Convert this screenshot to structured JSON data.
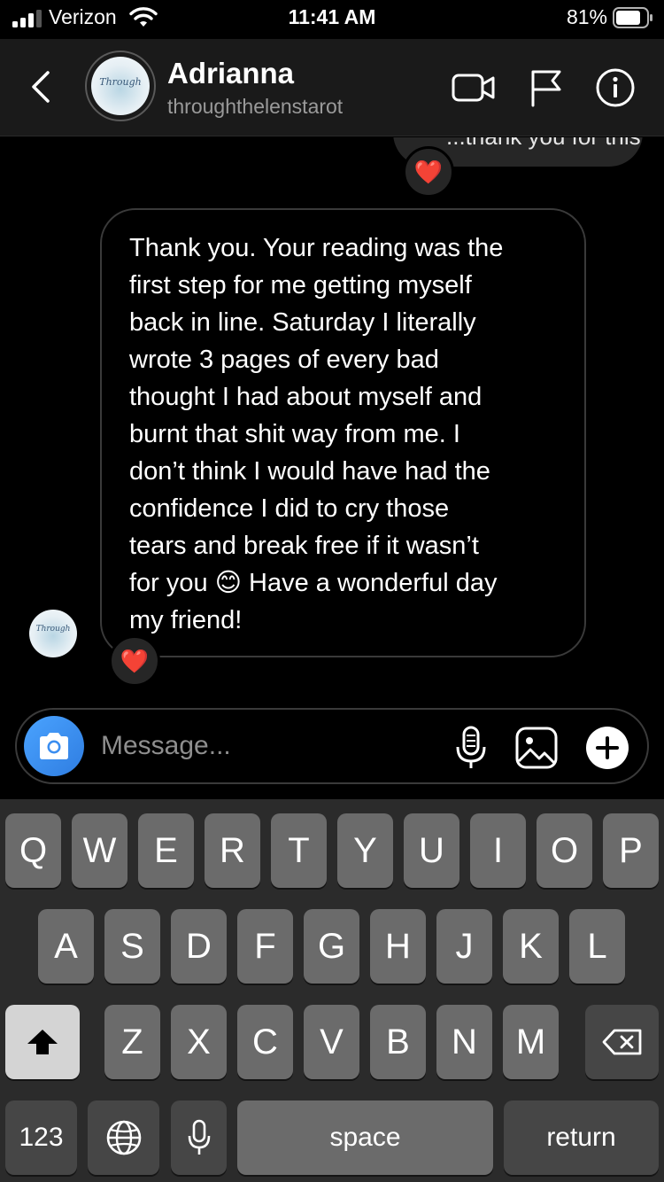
{
  "status_bar": {
    "carrier": "Verizon",
    "time": "11:41 AM",
    "battery_percent": "81%",
    "battery_level": 0.81,
    "signal_bars": 3
  },
  "header": {
    "contact_name": "Adrianna",
    "contact_handle": "throughthelenstarot",
    "avatar_logo_text": "Through"
  },
  "conversation": {
    "sent_message_partial": "...thank you for this",
    "sent_reaction": "❤️",
    "received_message": "Thank you. Your reading was the\nfirst step for me getting myself\nback in line.  Saturday I literally\nwrote 3 pages of every bad\nthought I had about myself and\nburnt that shit way from me. I\ndon’t think I would have had the\nconfidence I did to cry those\ntears and break free if it wasn’t\nfor you 😊 Have a wonderful day\nmy friend!",
    "received_reaction": "❤️"
  },
  "composer": {
    "placeholder": "Message..."
  },
  "keyboard": {
    "row1": [
      "Q",
      "W",
      "E",
      "R",
      "T",
      "Y",
      "U",
      "I",
      "O",
      "P"
    ],
    "row2": [
      "A",
      "S",
      "D",
      "F",
      "G",
      "H",
      "J",
      "K",
      "L"
    ],
    "row3": [
      "Z",
      "X",
      "C",
      "V",
      "B",
      "N",
      "M"
    ],
    "numbers_label": "123",
    "space_label": "space",
    "return_label": "return"
  },
  "colors": {
    "background": "#000000",
    "header_bg": "#1a1a1a",
    "accent_blue": "#3b8ef0",
    "key_bg": "#6b6b6b",
    "key_dark_bg": "#464646"
  }
}
